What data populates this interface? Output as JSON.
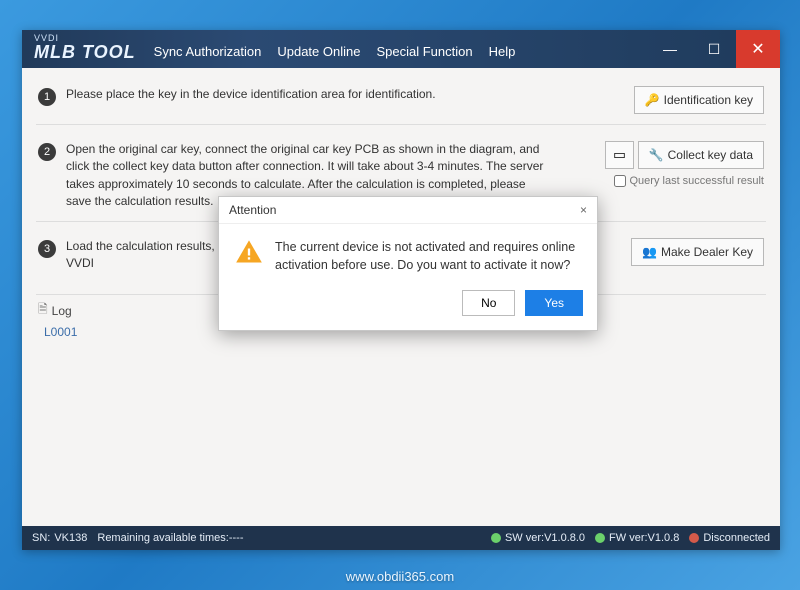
{
  "brand": {
    "small": "VVDI",
    "large": "MLB TOOL"
  },
  "menu": {
    "sync": "Sync Authorization",
    "update": "Update Online",
    "special": "Special Function",
    "help": "Help"
  },
  "steps": {
    "s1": {
      "num": "1",
      "text": "Please place the key in the device identification area for identification.",
      "btn": "Identification key"
    },
    "s2": {
      "num": "2",
      "text": "Open the original car key, connect the original car key PCB as shown in the diagram, and click the collect key data button after connection. It will take about 3-4 minutes. The server takes approximately 10 seconds to calculate. After the calculation is completed, please save the calculation results.",
      "btn_collect": "Collect key data",
      "checkbox": "Query last successful result"
    },
    "s3": {
      "num": "3",
      "text": "Load the calculation results, select the unused key ID to make dealer keys. Then use VVDI",
      "btn": "Make Dealer Key"
    }
  },
  "log": {
    "header": "Log",
    "line1": "L0001"
  },
  "status": {
    "sn_label": "SN:",
    "sn_value": "VK138",
    "remaining": "Remaining available times:----",
    "sw": "SW ver:V1.0.8.0",
    "fw": "FW ver:V1.0.8",
    "conn": "Disconnected"
  },
  "dialog": {
    "title": "Attention",
    "body": "The current device is not activated and requires online activation before use. Do you want to activate it now?",
    "no": "No",
    "yes": "Yes",
    "close": "×"
  },
  "footer_watermark": "www.obdii365.com"
}
